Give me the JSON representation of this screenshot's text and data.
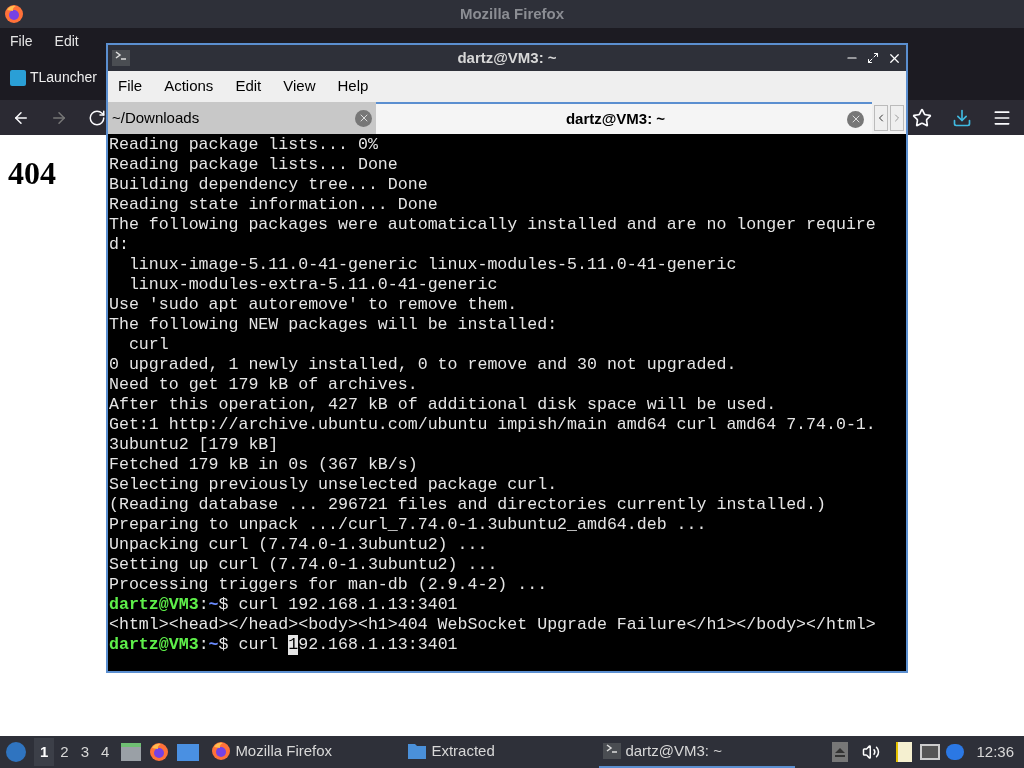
{
  "firefox": {
    "title": "Mozilla Firefox",
    "menu": [
      "File",
      "Edit"
    ],
    "tab": {
      "label": "TLauncher"
    },
    "page_heading": "404"
  },
  "terminal": {
    "title": "dartz@VM3: ~",
    "menu": [
      "File",
      "Actions",
      "Edit",
      "View",
      "Help"
    ],
    "tabs": [
      {
        "label": "~/Downloads",
        "selected": false
      },
      {
        "label": "dartz@VM3: ~",
        "selected": true
      }
    ],
    "lines": [
      {
        "kind": "output",
        "text": "Reading package lists... 0%"
      },
      {
        "kind": "output",
        "text": "Reading package lists... Done"
      },
      {
        "kind": "output",
        "text": "Building dependency tree... Done"
      },
      {
        "kind": "output",
        "text": "Reading state information... Done"
      },
      {
        "kind": "output",
        "text": "The following packages were automatically installed and are no longer require"
      },
      {
        "kind": "output",
        "text": "d:"
      },
      {
        "kind": "output",
        "text": "  linux-image-5.11.0-41-generic linux-modules-5.11.0-41-generic"
      },
      {
        "kind": "output",
        "text": "  linux-modules-extra-5.11.0-41-generic"
      },
      {
        "kind": "output",
        "text": "Use 'sudo apt autoremove' to remove them."
      },
      {
        "kind": "output",
        "text": "The following NEW packages will be installed:"
      },
      {
        "kind": "output",
        "text": "  curl"
      },
      {
        "kind": "output",
        "text": "0 upgraded, 1 newly installed, 0 to remove and 30 not upgraded."
      },
      {
        "kind": "output",
        "text": "Need to get 179 kB of archives."
      },
      {
        "kind": "output",
        "text": "After this operation, 427 kB of additional disk space will be used."
      },
      {
        "kind": "output",
        "text": "Get:1 http://archive.ubuntu.com/ubuntu impish/main amd64 curl amd64 7.74.0-1."
      },
      {
        "kind": "output",
        "text": "3ubuntu2 [179 kB]"
      },
      {
        "kind": "output",
        "text": "Fetched 179 kB in 0s (367 kB/s)"
      },
      {
        "kind": "output",
        "text": "Selecting previously unselected package curl."
      },
      {
        "kind": "output",
        "text": "(Reading database ... 296721 files and directories currently installed.)"
      },
      {
        "kind": "output",
        "text": "Preparing to unpack .../curl_7.74.0-1.3ubuntu2_amd64.deb ..."
      },
      {
        "kind": "output",
        "text": "Unpacking curl (7.74.0-1.3ubuntu2) ..."
      },
      {
        "kind": "output",
        "text": "Setting up curl (7.74.0-1.3ubuntu2) ..."
      },
      {
        "kind": "output",
        "text": "Processing triggers for man-db (2.9.4-2) ..."
      },
      {
        "kind": "prompt",
        "user": "dartz@VM3",
        "separator": ":",
        "path": "~",
        "symbol": "$",
        "command": "curl 192.168.1.13:3401"
      },
      {
        "kind": "output",
        "text": "<html><head></head><body><h1>404 WebSocket Upgrade Failure</h1></body></html>"
      },
      {
        "kind": "prompt",
        "user": "dartz@VM3",
        "separator": ":",
        "path": "~",
        "symbol": "$",
        "command": "curl ",
        "cursor_char": "1",
        "command_after": "92.168.1.13:3401"
      }
    ]
  },
  "taskbar": {
    "workspaces": [
      {
        "label": "1",
        "selected": true
      },
      {
        "label": "2",
        "selected": false
      },
      {
        "label": "3",
        "selected": false
      },
      {
        "label": "4",
        "selected": false
      }
    ],
    "tasks": [
      {
        "kind": "firefox",
        "label": "Mozilla Firefox",
        "selected": false
      },
      {
        "kind": "folder",
        "label": "Extracted",
        "selected": false
      },
      {
        "kind": "terminal",
        "label": "dartz@VM3: ~",
        "selected": true
      }
    ],
    "clock": "12:36"
  }
}
